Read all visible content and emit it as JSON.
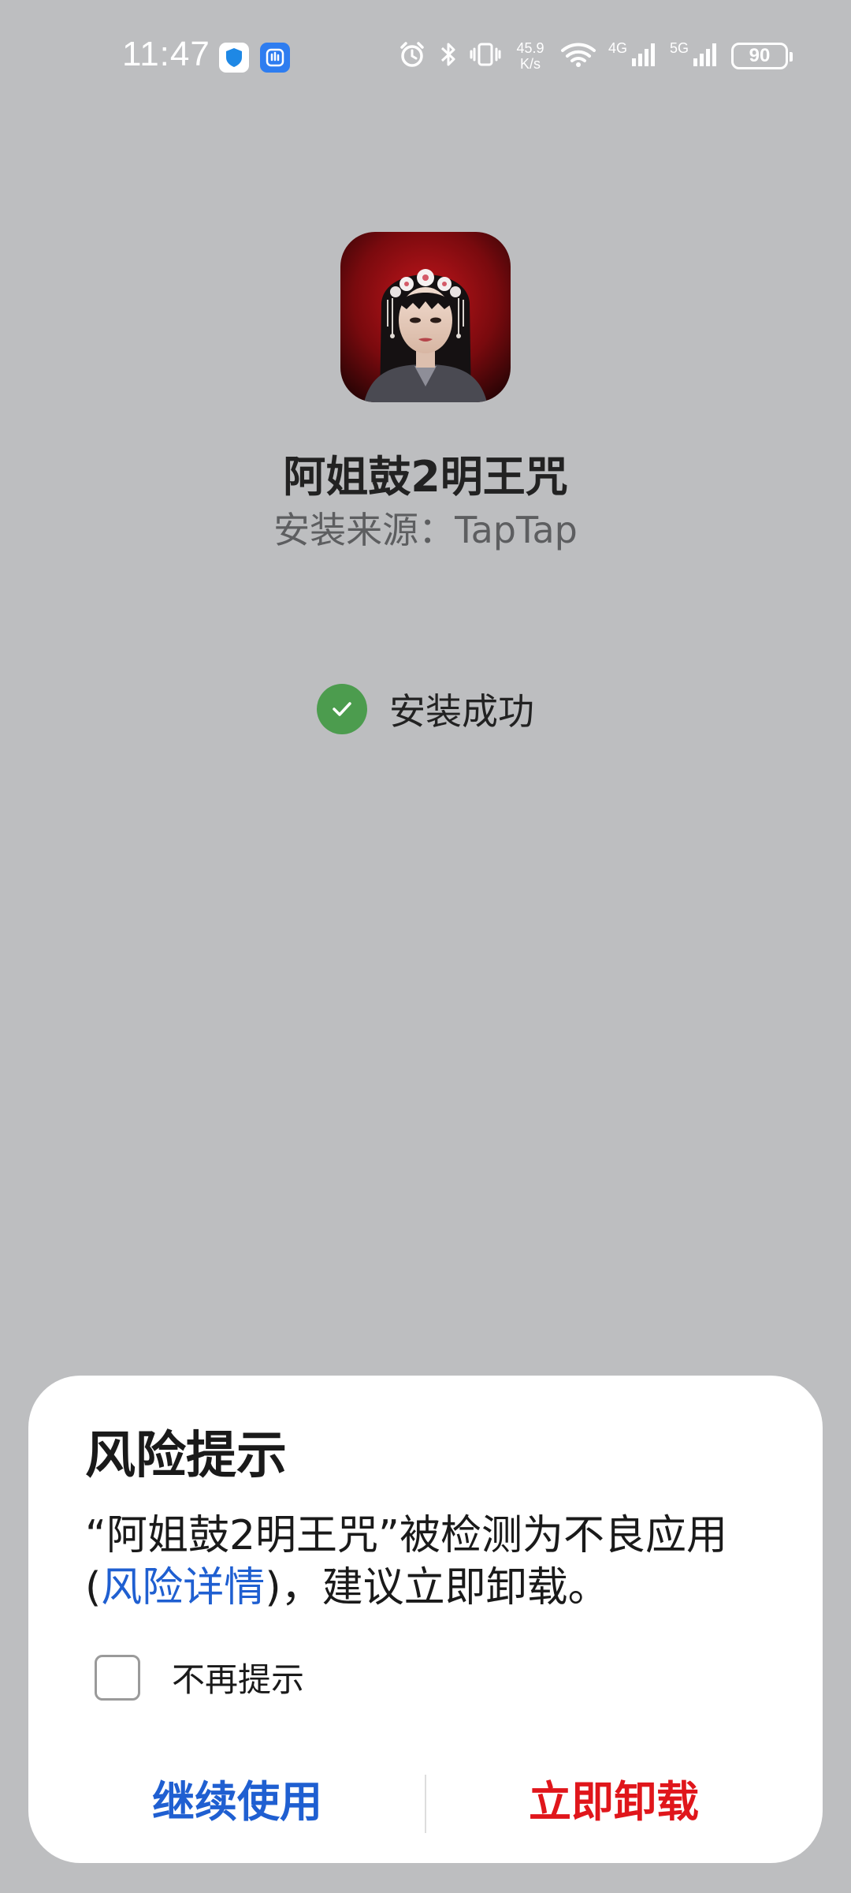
{
  "status_bar": {
    "time": "11:47",
    "network_speed_value": "45.9",
    "network_speed_unit": "K/s",
    "net1": "4G",
    "net2": "5G",
    "battery": "90",
    "icons": [
      "shield-app-icon",
      "blue-app-icon",
      "alarm-icon",
      "bluetooth-icon",
      "vibrate-icon",
      "wifi-icon",
      "signal-4g-icon",
      "signal-5g-icon",
      "battery-icon"
    ]
  },
  "app": {
    "name": "阿姐鼓2明王咒",
    "install_source": "安装来源：TapTap",
    "install_status": "安装成功"
  },
  "dialog": {
    "title": "风险提示",
    "message_prefix": "“阿姐鼓2明王咒”被检测为不良应用 (",
    "message_link": "风险详情",
    "message_suffix": ")，建议立即卸载。",
    "checkbox_label": "不再提示",
    "continue_label": "继续使用",
    "uninstall_label": "立即卸载"
  },
  "colors": {
    "background": "#bdbec0",
    "link_blue": "#1f5fd1",
    "danger_red": "#e0161b",
    "success_green": "#4c9c4e"
  }
}
